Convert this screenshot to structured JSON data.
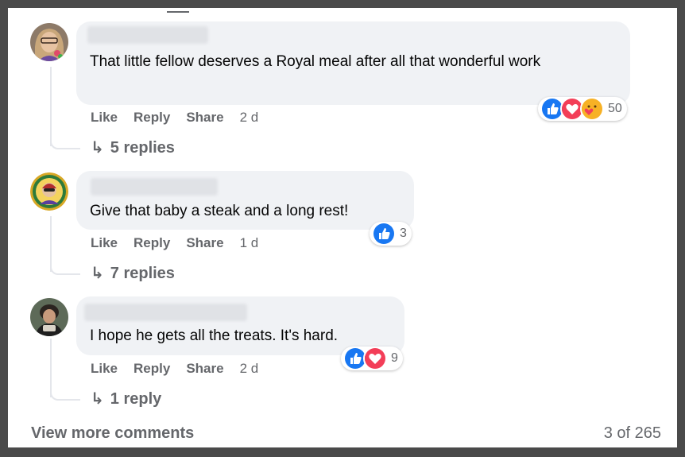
{
  "comments": [
    {
      "text": "That little fellow deserves a Royal meal after all that wonderful work",
      "actions": {
        "like": "Like",
        "reply": "Reply",
        "share": "Share",
        "time": "2 d"
      },
      "reaction_icons": [
        "like-icon",
        "love-icon",
        "care-icon"
      ],
      "reaction_count": "50",
      "replies": "5 replies"
    },
    {
      "text": "Give that baby a steak and a long rest!",
      "actions": {
        "like": "Like",
        "reply": "Reply",
        "share": "Share",
        "time": "1 d"
      },
      "reaction_icons": [
        "like-icon"
      ],
      "reaction_count": "3",
      "replies": "7 replies"
    },
    {
      "text": "I hope he gets all the treats. It's hard.",
      "actions": {
        "like": "Like",
        "reply": "Reply",
        "share": "Share",
        "time": "2 d"
      },
      "reaction_icons": [
        "like-icon",
        "love-icon"
      ],
      "reaction_count": "9",
      "replies": "1 reply"
    }
  ],
  "footer": {
    "view_more": "View more comments",
    "count": "3 of 265"
  },
  "colors": {
    "like": "#1877f2",
    "love": "#f33e58",
    "care": "#f7b125",
    "bubble": "#f0f2f5",
    "secondary_text": "#65676b"
  }
}
